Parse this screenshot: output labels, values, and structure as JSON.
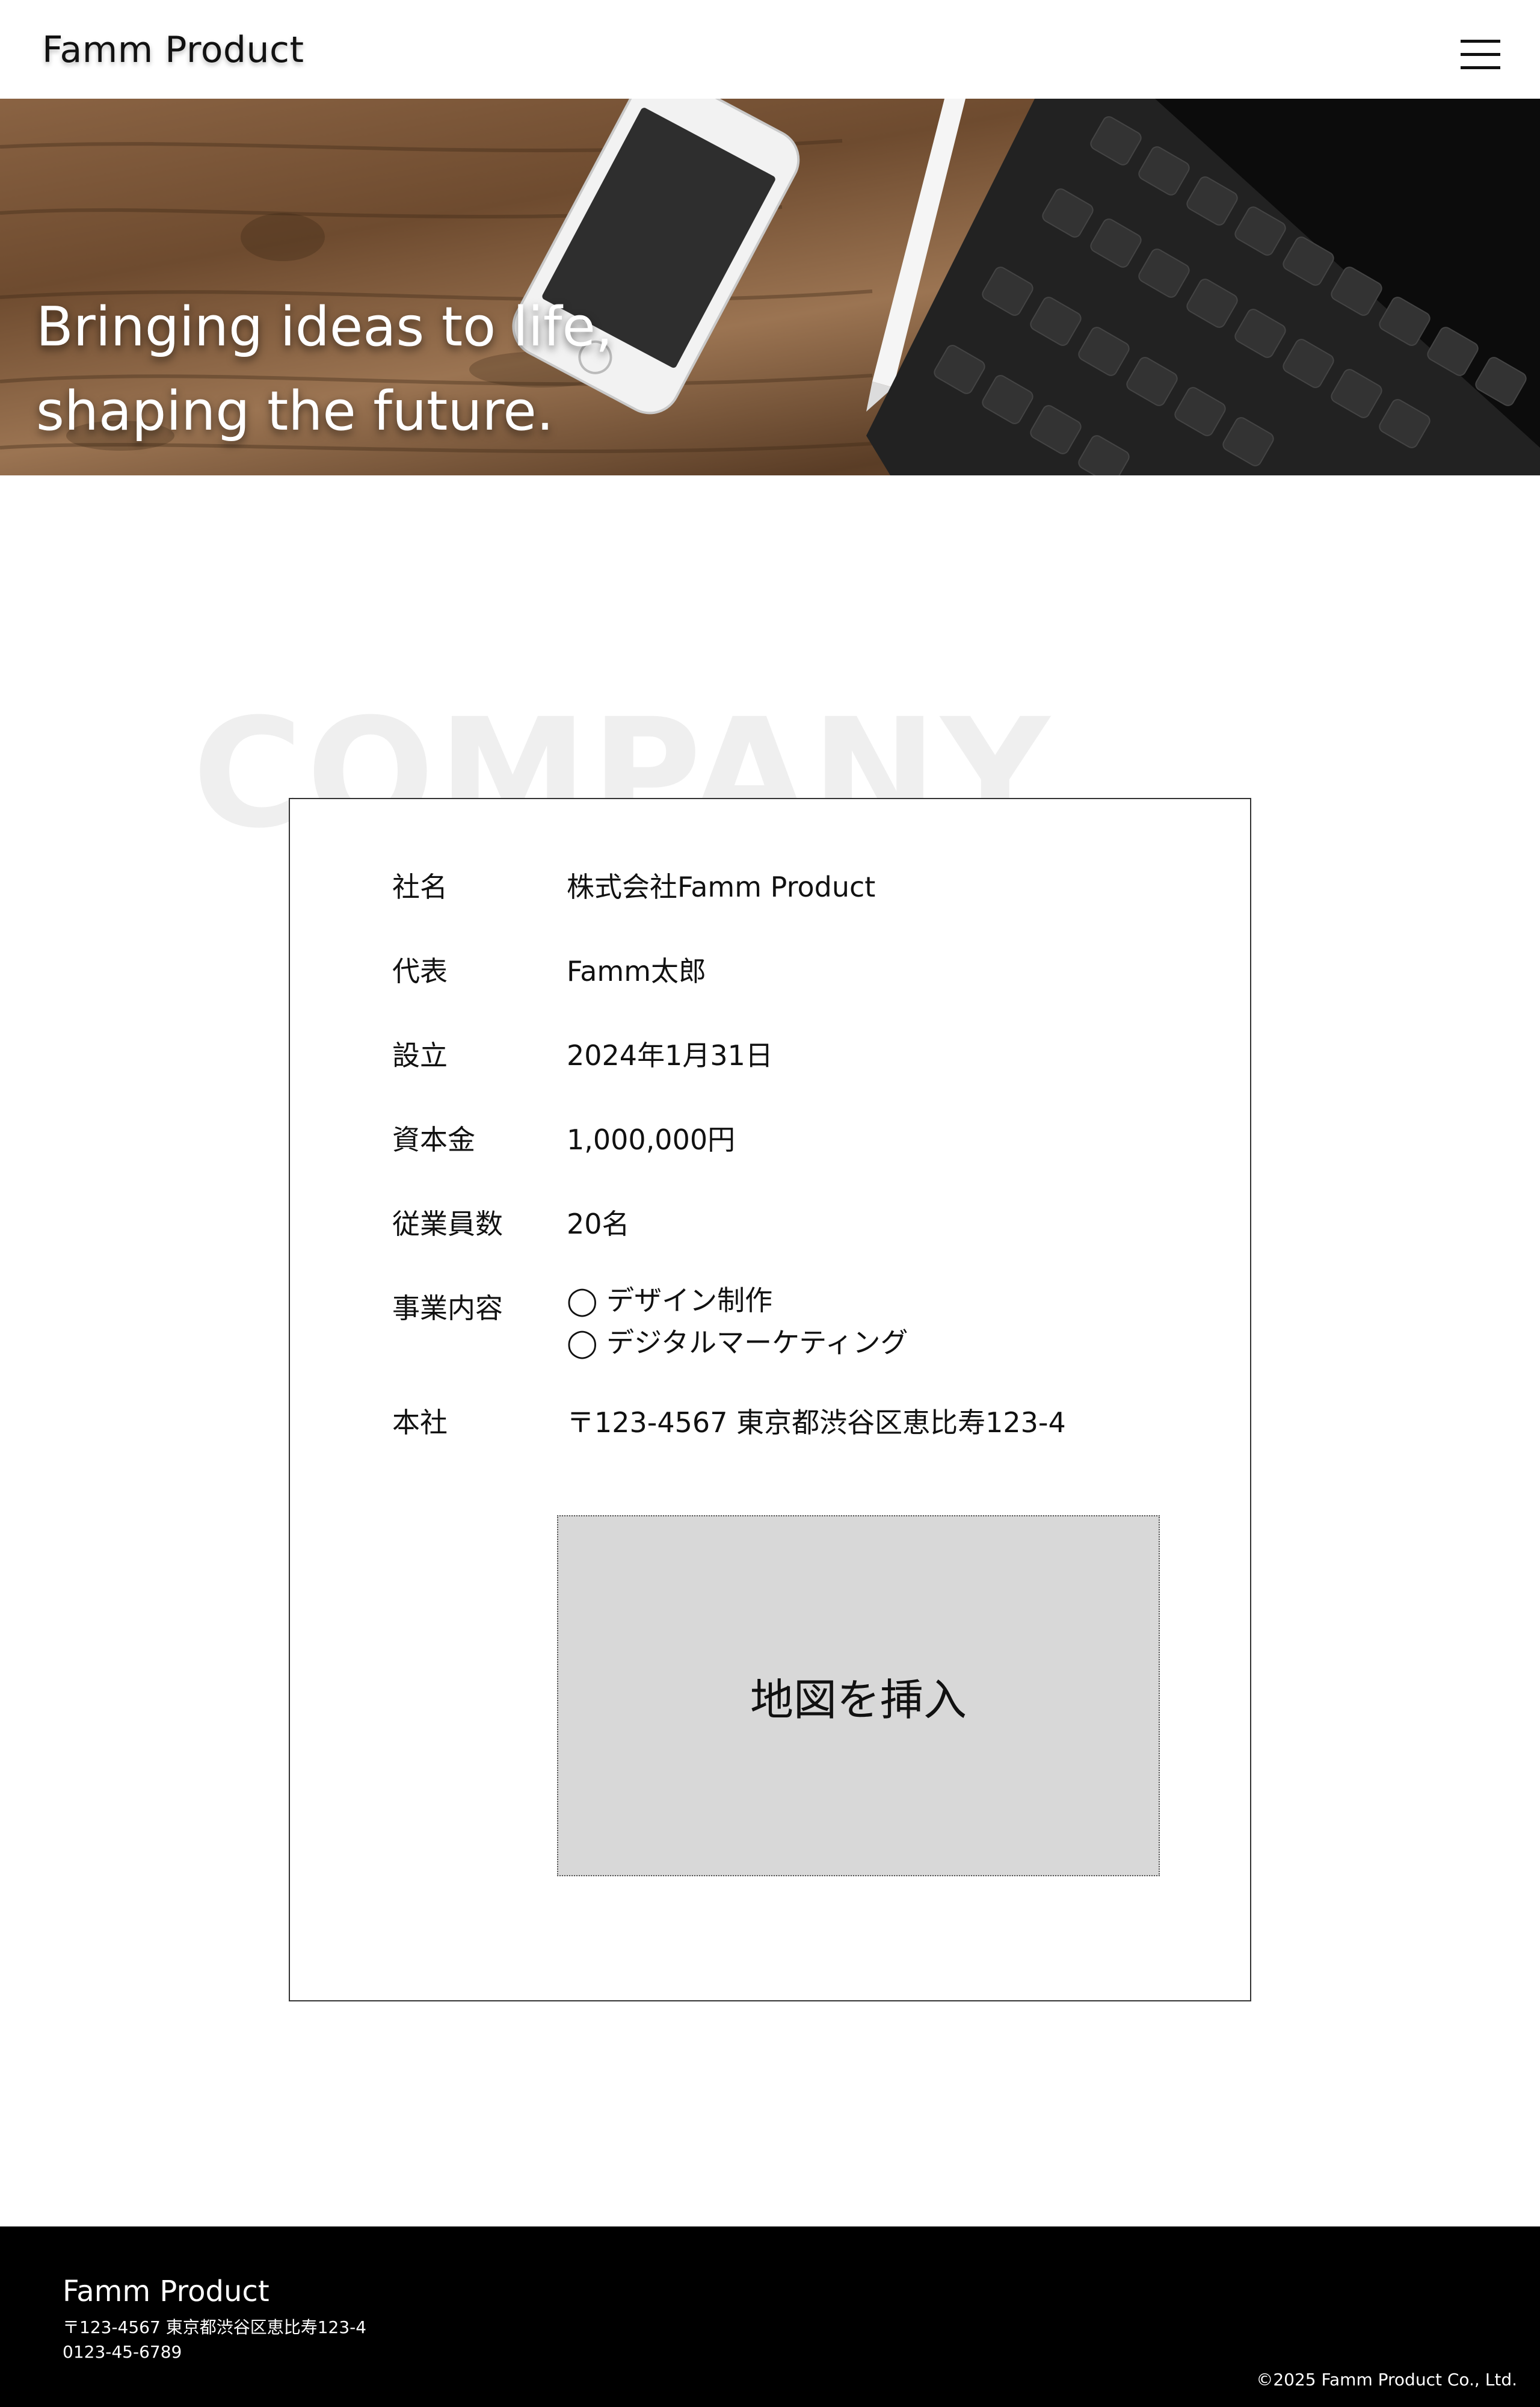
{
  "header": {
    "logo": "Famm Product",
    "menu_icon": "hamburger-menu-icon"
  },
  "hero": {
    "line1": "Bringing ideas to life,",
    "line2": "shaping the future."
  },
  "section": {
    "watermark": "COMPANY"
  },
  "company": {
    "rows": [
      {
        "label": "社名",
        "value": "株式会社Famm Product"
      },
      {
        "label": "代表",
        "value": "Famm太郎"
      },
      {
        "label": "設立",
        "value": "2024年1月31日"
      },
      {
        "label": "資本金",
        "value": "1,000,000円"
      },
      {
        "label": "従業員数",
        "value": "20名"
      },
      {
        "label": "事業内容",
        "values": [
          "◯ デザイン制作",
          "◯ デジタルマーケティング"
        ]
      },
      {
        "label": "本社",
        "value": "〒123-4567 東京都渋谷区恵比寿123-4"
      }
    ],
    "map_placeholder": "地図を挿入"
  },
  "footer": {
    "name": "Famm Product",
    "address": "〒123-4567 東京都渋谷区恵比寿123-4",
    "tel": "0123-45-6789",
    "copyright": "©2025 Famm Product Co., Ltd."
  },
  "colors": {
    "footer_bg": "#000000",
    "map_bg": "#d8d8d8",
    "watermark": "#efefef"
  }
}
